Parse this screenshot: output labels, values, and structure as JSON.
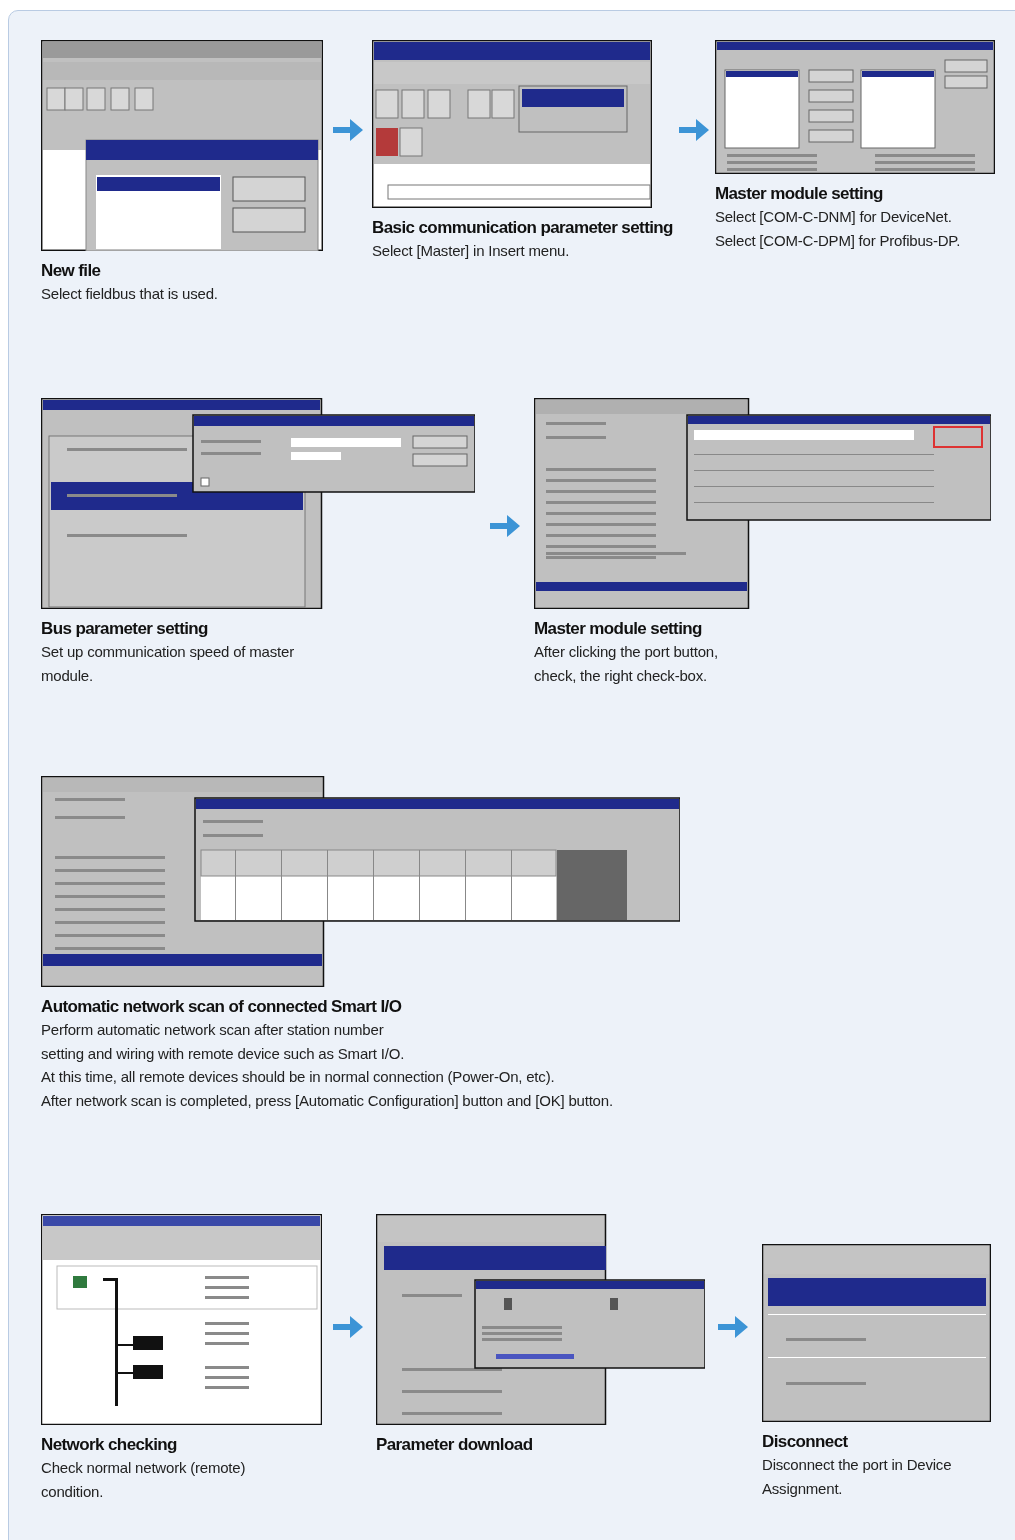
{
  "rows": [
    {
      "steps": [
        {
          "kind": "fieldbus-dialog",
          "title": "New file",
          "description": [
            "Select fieldbus that is used."
          ]
        },
        {
          "kind": "insert-menu",
          "title": "Basic communication parameter setting",
          "description": [
            "Select [Master] in Insert menu."
          ]
        },
        {
          "kind": "master-list",
          "title": "Master module setting",
          "description": [
            "Select [COM-C-DNM] for DeviceNet.",
            "Select [COM-C-DPM] for Profibus-DP."
          ]
        }
      ]
    },
    {
      "steps": [
        {
          "kind": "bus-menu",
          "title": "Bus parameter setting",
          "description": [
            "Set up communication speed of master",
            "module."
          ]
        },
        {
          "kind": "master-port",
          "title": "Master module setting",
          "description": [
            "After clicking the port button,",
            "check, the right check-box."
          ]
        }
      ]
    },
    {
      "steps": [
        {
          "kind": "scan-menu",
          "title": "Automatic network scan of connected Smart I/O",
          "description": [
            "Perform automatic network scan after station number",
            "setting and wiring with remote device such as Smart I/O.",
            "At this time, all remote devices should be in normal connection (Power-On, etc).",
            "After network scan is completed, press [Automatic Configuration] button and [OK] button."
          ]
        }
      ]
    },
    {
      "steps": [
        {
          "kind": "network-view",
          "title": "Network checking",
          "description": [
            "Check normal network (remote)",
            "condition."
          ]
        },
        {
          "kind": "download-menu",
          "title": "Parameter download"
        },
        {
          "kind": "settings-menu",
          "title": "Disconnect",
          "description": [
            "Disconnect the port in Device",
            "Assignment."
          ]
        }
      ]
    }
  ]
}
